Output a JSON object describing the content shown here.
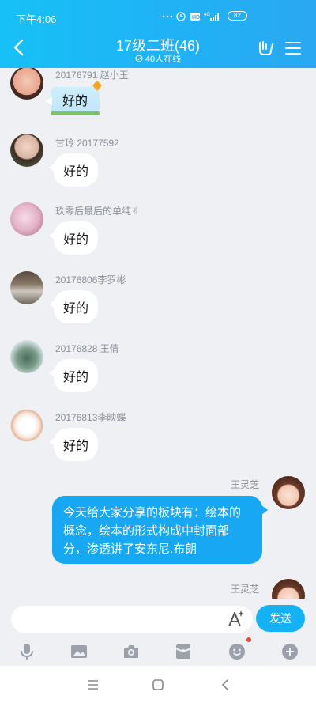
{
  "status": {
    "time": "下午4:06",
    "battery": "82",
    "net": "4G",
    "hd": "HD"
  },
  "header": {
    "title": "17级二班(46)",
    "online": "40人在线"
  },
  "messages": [
    {
      "name": "20176791 赵小玉",
      "text": "好的"
    },
    {
      "name": "甘玲 20177592",
      "text": "好的"
    },
    {
      "name": "玖零后最后的单纯✌",
      "text": "好的"
    },
    {
      "name": "20176806李罗彬",
      "text": "好的"
    },
    {
      "name": "20176828 王倩",
      "text": "好的"
    },
    {
      "name": "20176813李映蝶",
      "text": "好的"
    },
    {
      "name": "王灵芝",
      "text": "今天给大家分享的板块有：绘本的概念，绘本的形式构成中封面部分，渗透讲了安东尼.布朗"
    },
    {
      "name": "王灵芝",
      "text": ""
    }
  ],
  "input": {
    "placeholder": "",
    "send_label": "发送"
  },
  "colors": {
    "header": "#1fb3f5",
    "my_bubble": "#17a7f3",
    "send": "#14b2f4"
  }
}
